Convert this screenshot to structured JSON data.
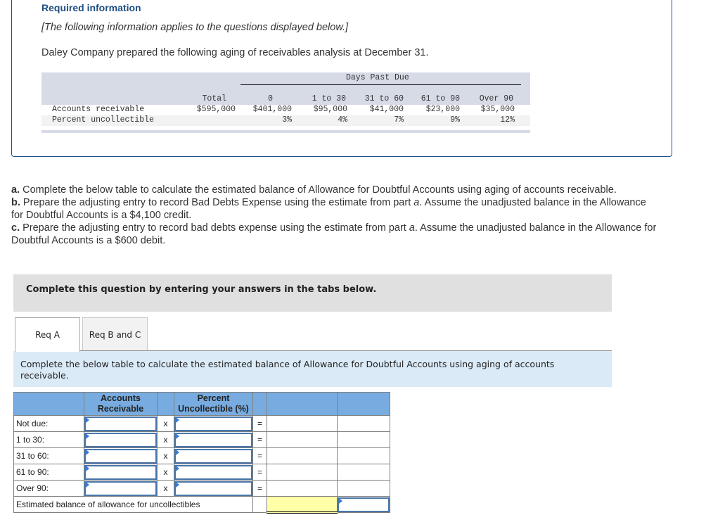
{
  "header": {
    "title": "Required information",
    "note": "[The following information applies to the questions displayed below.]",
    "intro": "Daley Company prepared the following aging of receivables analysis at December 31."
  },
  "aging_table": {
    "group_header": "Days Past Due",
    "columns": [
      "Total",
      "0",
      "1 to 30",
      "31 to 60",
      "61 to 90",
      "Over 90"
    ],
    "rows": [
      {
        "label": "Accounts receivable",
        "values": [
          "$595,000",
          "$401,000",
          "$95,000",
          "$41,000",
          "$23,000",
          "$35,000"
        ]
      },
      {
        "label": "Percent uncollectible",
        "values": [
          "",
          "3%",
          "4%",
          "7%",
          "9%",
          "12%"
        ]
      }
    ]
  },
  "questions": {
    "a_prefix": "a.",
    "a_text": " Complete the below table to calculate the estimated balance of Allowance for Doubtful Accounts using aging of accounts receivable.",
    "b_prefix": "b.",
    "b_text1": " Prepare the adjusting entry to record Bad Debts Expense using the estimate from part ",
    "b_italic": "a",
    "b_text2": ". Assume the unadjusted balance in the Allowance for Doubtful Accounts is a $4,100 credit.",
    "c_prefix": "c.",
    "c_text1": " Prepare the adjusting entry to record bad debts expense using the estimate from part ",
    "c_italic": "a",
    "c_text2": ". Assume the unadjusted balance in the Allowance for Doubtful Accounts is a $600 debit."
  },
  "banner": "Complete this question by entering your answers in the tabs below.",
  "tabs": [
    {
      "label": "Req A",
      "active": true
    },
    {
      "label": "Req B and C",
      "active": false
    }
  ],
  "tab_instruction": "Complete the below table to calculate the estimated balance of Allowance for Doubtful Accounts using aging of accounts receivable.",
  "answer_table": {
    "headers": [
      "",
      "Accounts Receivable",
      "",
      "Percent Uncollectible (%)",
      "",
      "",
      ""
    ],
    "multiply_symbol": "x",
    "equals_symbol": "=",
    "rows": [
      {
        "label": "Not due:",
        "accounts_receivable": "",
        "percent": ""
      },
      {
        "label": "1 to 30:",
        "accounts_receivable": "",
        "percent": ""
      },
      {
        "label": "31 to 60:",
        "accounts_receivable": "",
        "percent": ""
      },
      {
        "label": "61 to 90:",
        "accounts_receivable": "",
        "percent": ""
      },
      {
        "label": "Over 90:",
        "accounts_receivable": "",
        "percent": ""
      }
    ],
    "total_label": "Estimated balance of allowance for uncollectibles",
    "total_value": ""
  }
}
